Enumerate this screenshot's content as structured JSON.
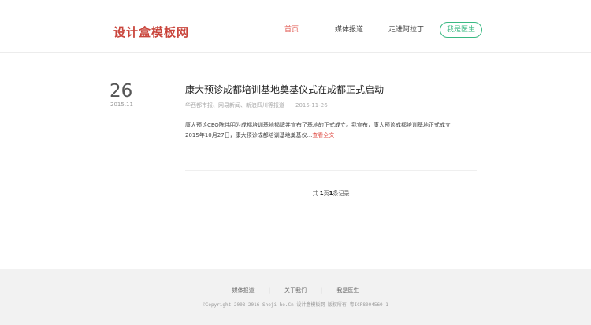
{
  "header": {
    "logo": "设计盒模板网",
    "nav": [
      {
        "label": "首页",
        "active": true
      },
      {
        "label": "媒体报道",
        "active": false
      },
      {
        "label": "走进阿拉丁",
        "active": false
      }
    ],
    "cta_label": "我是医生"
  },
  "article": {
    "day": "26",
    "year_month": "2015.11",
    "title": "康大预诊成都培训基地奠基仪式在成都正式启动",
    "meta_source": "华西都市报、网易新闻、新浪四川等报道",
    "meta_date": "2015-11-26",
    "summary": "康大预诊CEO陈伟明为成都培训基地揭牌并宣布了基地的正式成立。我宣布，康大预诊成都培训基地正式成立！2015年10月27日，康大预诊成都培训基地奠基仪...",
    "read_more": "查看全文"
  },
  "pager": {
    "prefix": "共",
    "total_pages": "1",
    "mid": "页",
    "total_records": "1",
    "suffix": "条记录"
  },
  "footer": {
    "links": [
      "媒体报道",
      "关于我们",
      "我是医生"
    ],
    "copyright": "©Copyright 2008-2016 Sheji he.Cn 设计盒模板网 版权所有 粤ICP8004560-1"
  },
  "colors": {
    "accent_red": "#e0514a",
    "logo_red": "#c9453c",
    "cta_green": "#39b982",
    "footer_bg": "#f2f2f2"
  }
}
